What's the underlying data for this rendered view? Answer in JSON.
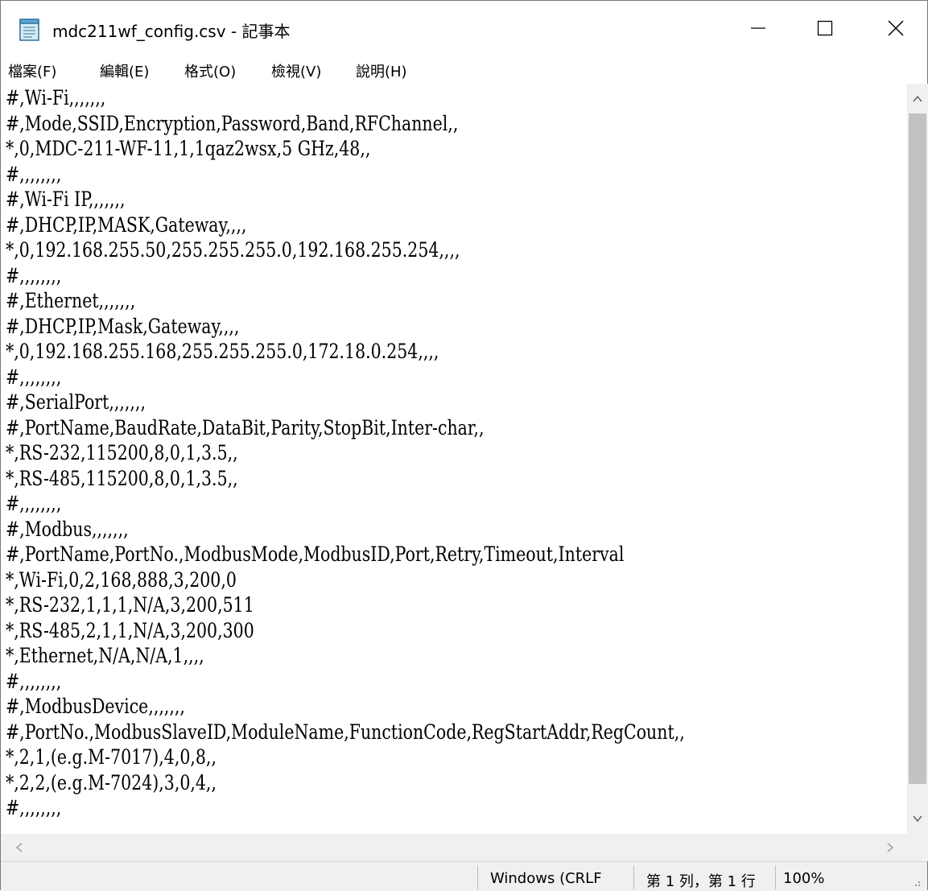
{
  "window": {
    "title": "mdc211wf_config.csv - 記事本",
    "minimize_label": "—",
    "maximize_label": "☐",
    "close_label": "✕"
  },
  "menu": [
    {
      "label": "檔案(F)"
    },
    {
      "label": "編輯(E)"
    },
    {
      "label": "格式(O)"
    },
    {
      "label": "檢視(V)"
    },
    {
      "label": "說明(H)"
    }
  ],
  "editor": {
    "lines": [
      "#,Wi-Fi,,,,,,,",
      "#,Mode,SSID,Encryption,Password,Band,RFChannel,,",
      "*,0,MDC-211-WF-11,1,1qaz2wsx,5 GHz,48,,",
      "#,,,,,,,,",
      "#,Wi-Fi IP,,,,,,,",
      "#,DHCP,IP,MASK,Gateway,,,,",
      "*,0,192.168.255.50,255.255.255.0,192.168.255.254,,,,",
      "#,,,,,,,,",
      "#,Ethernet,,,,,,,",
      "#,DHCP,IP,Mask,Gateway,,,,",
      "*,0,192.168.255.168,255.255.255.0,172.18.0.254,,,,",
      "#,,,,,,,,",
      "#,SerialPort,,,,,,,",
      "#,PortName,BaudRate,DataBit,Parity,StopBit,Inter-char,,",
      "*,RS-232,115200,8,0,1,3.5,,",
      "*,RS-485,115200,8,0,1,3.5,,",
      "#,,,,,,,,",
      "#,Modbus,,,,,,,",
      "#,PortName,PortNo.,ModbusMode,ModbusID,Port,Retry,Timeout,Interval",
      "*,Wi-Fi,0,2,168,888,3,200,0",
      "*,RS-232,1,1,1,N/A,3,200,511",
      "*,RS-485,2,1,1,N/A,3,200,300",
      "*,Ethernet,N/A,N/A,1,,,,",
      "#,,,,,,,,",
      "#,ModbusDevice,,,,,,,",
      "#,PortNo.,ModbusSlaveID,ModuleName,FunctionCode,RegStartAddr,RegCount,,",
      "*,2,1,(e.g.M-7017),4,0,8,,",
      "*,2,2,(e.g.M-7024),3,0,4,,",
      "#,,,,,,,,"
    ]
  },
  "statusbar": {
    "line_ending": "Windows (CRLF",
    "position": "第 1 列，第 1 行",
    "zoom": "100%"
  },
  "colors": {
    "background": "#ffffff",
    "chrome": "#f0f0f0",
    "scroll_thumb": "#c2c2c2",
    "text": "#000000"
  }
}
